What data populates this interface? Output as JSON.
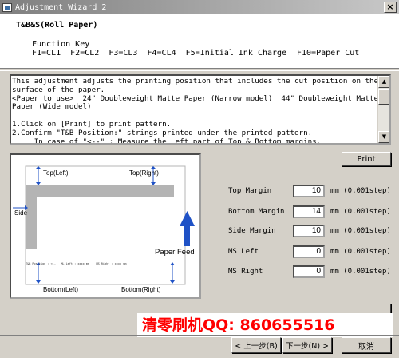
{
  "window": {
    "title": "Adjustment Wizard 2",
    "close_glyph": "×"
  },
  "header": {
    "title": "T&B&S(Roll Paper)",
    "function_key_label": "Function Key",
    "function_keys": "F1=CL1  F2=CL2  F3=CL3  F4=CL4  F5=Initial Ink Charge",
    "f10": "F10=Paper Cut"
  },
  "description": {
    "lines": [
      "This adjustment adjusts the printing position that includes the cut position on the",
      "surface of the paper.",
      "<Paper to use>  24\" Doubleweight Matte Paper (Narrow model)  44\" Doubleweight Matte",
      "Paper (Wide model)",
      "",
      "1.Click on [Print] to print pattern.",
      "2.Confirm \"T&B Position:\" strings printed under the printed pattern.",
      "     In case of \"<--\" : Measure the Left part of Top & Bottom margins."
    ]
  },
  "print_button": "Print",
  "figure": {
    "top_left": "Top(Left)",
    "top_right": "Top(Right)",
    "side": "Side",
    "paper_feed": "Paper Feed",
    "tb_position_line": "T&B Position : <--   ML Left : xxxx mm    MS Right : xxxx mm",
    "bottom_left": "Bottom(Left)",
    "bottom_right": "Bottom(Right)"
  },
  "fields": [
    {
      "label": "Top Margin",
      "value": "10",
      "unit": "mm (0.001step)"
    },
    {
      "label": "Bottom Margin",
      "value": "14",
      "unit": "mm (0.001step)"
    },
    {
      "label": "Side Margin",
      "value": "10",
      "unit": "mm (0.001step)"
    },
    {
      "label": "MS Left",
      "value": "0",
      "unit": "mm (0.001step)"
    },
    {
      "label": "MS Right",
      "value": "0",
      "unit": "mm (0.001step)"
    }
  ],
  "overlay": "清零刷机QQ:  860655516",
  "buttons": {
    "back": "< 上一步(B)",
    "next": "下一步(N) >",
    "cancel": "取消"
  },
  "colors": {
    "arrow_blue": "#1f52c6",
    "overlay_red": "#ff0000"
  }
}
